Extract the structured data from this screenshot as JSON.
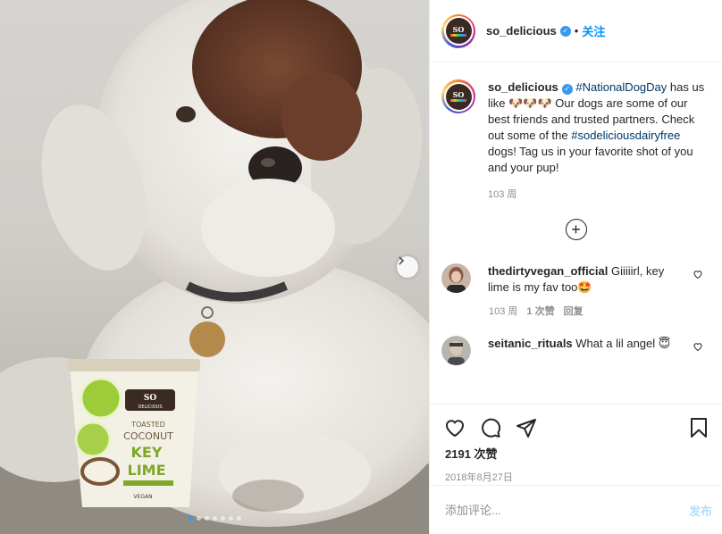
{
  "post": {
    "image_alt": "White and brown doodle dog with a So Delicious Key Lime pint",
    "carousel_count": 7,
    "carousel_active": 0
  },
  "container": {
    "brand_top": "SO",
    "brand_bottom": "DELICIOUS",
    "line1": "TOASTED",
    "line2": "COCONUT",
    "flavor1": "KEY",
    "flavor2": "LIME",
    "badge": "VEGAN"
  },
  "header": {
    "username": "so_delicious",
    "separator": "•",
    "follow_label": "关注",
    "avatar_text": "SO"
  },
  "caption": {
    "username": "so_delicious",
    "hashtag1": "#NationalDogDay",
    "text1": " has us like 🐶🐶🐶 Our dogs are some of our best friends and trusted partners. Check out some of the ",
    "hashtag2": "#sodeliciousdairyfree",
    "text2": " dogs! Tag us in your favorite shot of you and your pup!",
    "time": "103 周"
  },
  "load_more": "+",
  "comments": [
    {
      "username": "thedirtyvegan_official",
      "text": " Giiiiirl, key lime is my fav too🤩",
      "time": "103 周",
      "likes": "1 次赞",
      "reply": "回复"
    },
    {
      "username": "seitanic_rituals",
      "text": " What a lil angel 😇"
    }
  ],
  "actions": {
    "likes": "2191 次赞",
    "date": "2018年8月27日"
  },
  "add_comment": {
    "placeholder": "添加评论...",
    "post_label": "发布"
  },
  "colors": {
    "accent": "#0095f6",
    "verified": "#3897f0",
    "muted": "#8e8e8e",
    "post_disabled": "#b2dffc"
  }
}
